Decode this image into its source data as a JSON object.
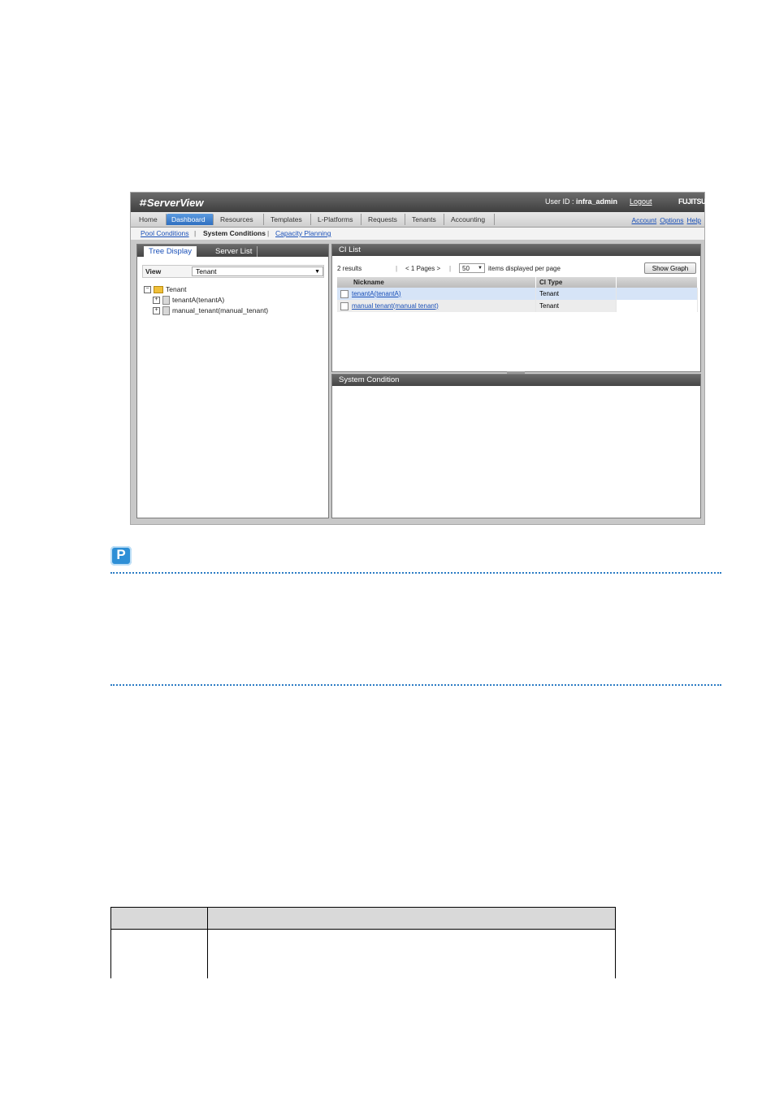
{
  "app": {
    "logo": "ServerView",
    "logo_mark": "⌗",
    "user_id_label": "User ID : ",
    "user_id": "infra_admin",
    "logout": "Logout",
    "brand": "FUJITSU"
  },
  "tabs": [
    "Home",
    "Dashboard",
    "Resources",
    "Templates",
    "L-Platforms",
    "Requests",
    "Tenants",
    "Accounting"
  ],
  "active_tab": "Dashboard",
  "top_links": [
    "Account",
    "Options",
    "Help"
  ],
  "subnav": {
    "pool_conditions": "Pool Conditions",
    "system_conditions": "System Conditions",
    "capacity_planning": "Capacity Planning"
  },
  "left_panel": {
    "tab_tree": "Tree Display",
    "tab_server": "Server List",
    "view_label": "View",
    "view_value": "Tenant",
    "tree": {
      "root": "Tenant",
      "children": [
        "tenantA(tenantA)",
        "manual_tenant(manual_tenant)"
      ]
    }
  },
  "ci_list": {
    "title": "CI List",
    "results": "2  results",
    "pages": "< 1 Pages >",
    "per_page": "50",
    "per_page_label": "items displayed per page",
    "show_graph": "Show Graph",
    "columns": [
      "Nickname",
      "CI Type"
    ],
    "rows": [
      {
        "nickname": "tenantA(tenantA)",
        "type": "Tenant"
      },
      {
        "nickname": "manual tenant(manual tenant)",
        "type": "Tenant"
      }
    ]
  },
  "system_condition": {
    "title": "System Condition"
  },
  "point_icon": "P"
}
